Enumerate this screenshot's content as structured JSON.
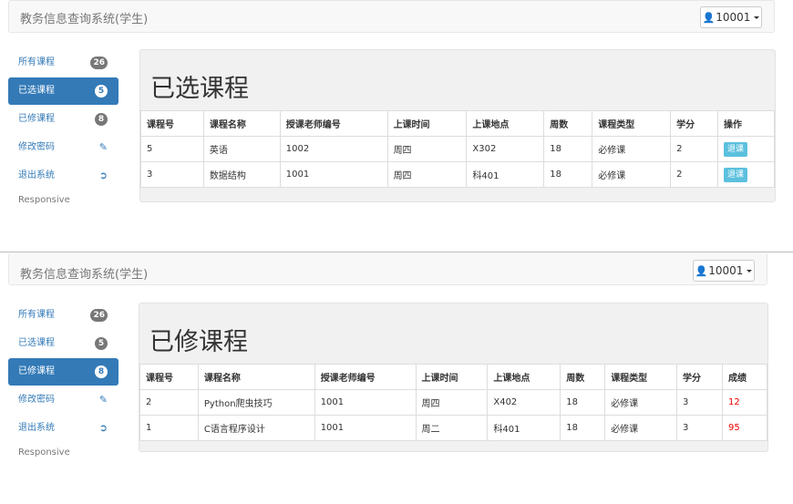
{
  "app": {
    "title": "教务信息查询系统(学生)",
    "user": "10001"
  },
  "sidebar": {
    "items": [
      {
        "label": "所有课程",
        "badge": "26"
      },
      {
        "label": "已选课程",
        "badge": "5"
      },
      {
        "label": "已修课程",
        "badge": "8"
      },
      {
        "label": "修改密码",
        "icon": "pencil-icon"
      },
      {
        "label": "退出系统",
        "icon": "logout-icon"
      }
    ],
    "footer": "Responsive"
  },
  "selected": {
    "title": "已选课程",
    "headers": [
      "课程号",
      "课程名称",
      "授课老师编号",
      "上课时间",
      "上课地点",
      "周数",
      "课程类型",
      "学分",
      "操作"
    ],
    "rows": [
      [
        "5",
        "英语",
        "1002",
        "周四",
        "X302",
        "18",
        "必修课",
        "2",
        "退课"
      ],
      [
        "3",
        "数据结构",
        "1001",
        "周四",
        "科401",
        "18",
        "必修课",
        "2",
        "退课"
      ]
    ]
  },
  "completed": {
    "title": "已修课程",
    "headers": [
      "课程号",
      "课程名称",
      "授课老师编号",
      "上课时间",
      "上课地点",
      "周数",
      "课程类型",
      "学分",
      "成绩"
    ],
    "rows": [
      [
        "2",
        "Python爬虫技巧",
        "1001",
        "周四",
        "X402",
        "18",
        "必修课",
        "3",
        "12"
      ],
      [
        "1",
        "C语言程序设计",
        "1001",
        "周二",
        "科401",
        "18",
        "必修课",
        "3",
        "95"
      ]
    ]
  }
}
